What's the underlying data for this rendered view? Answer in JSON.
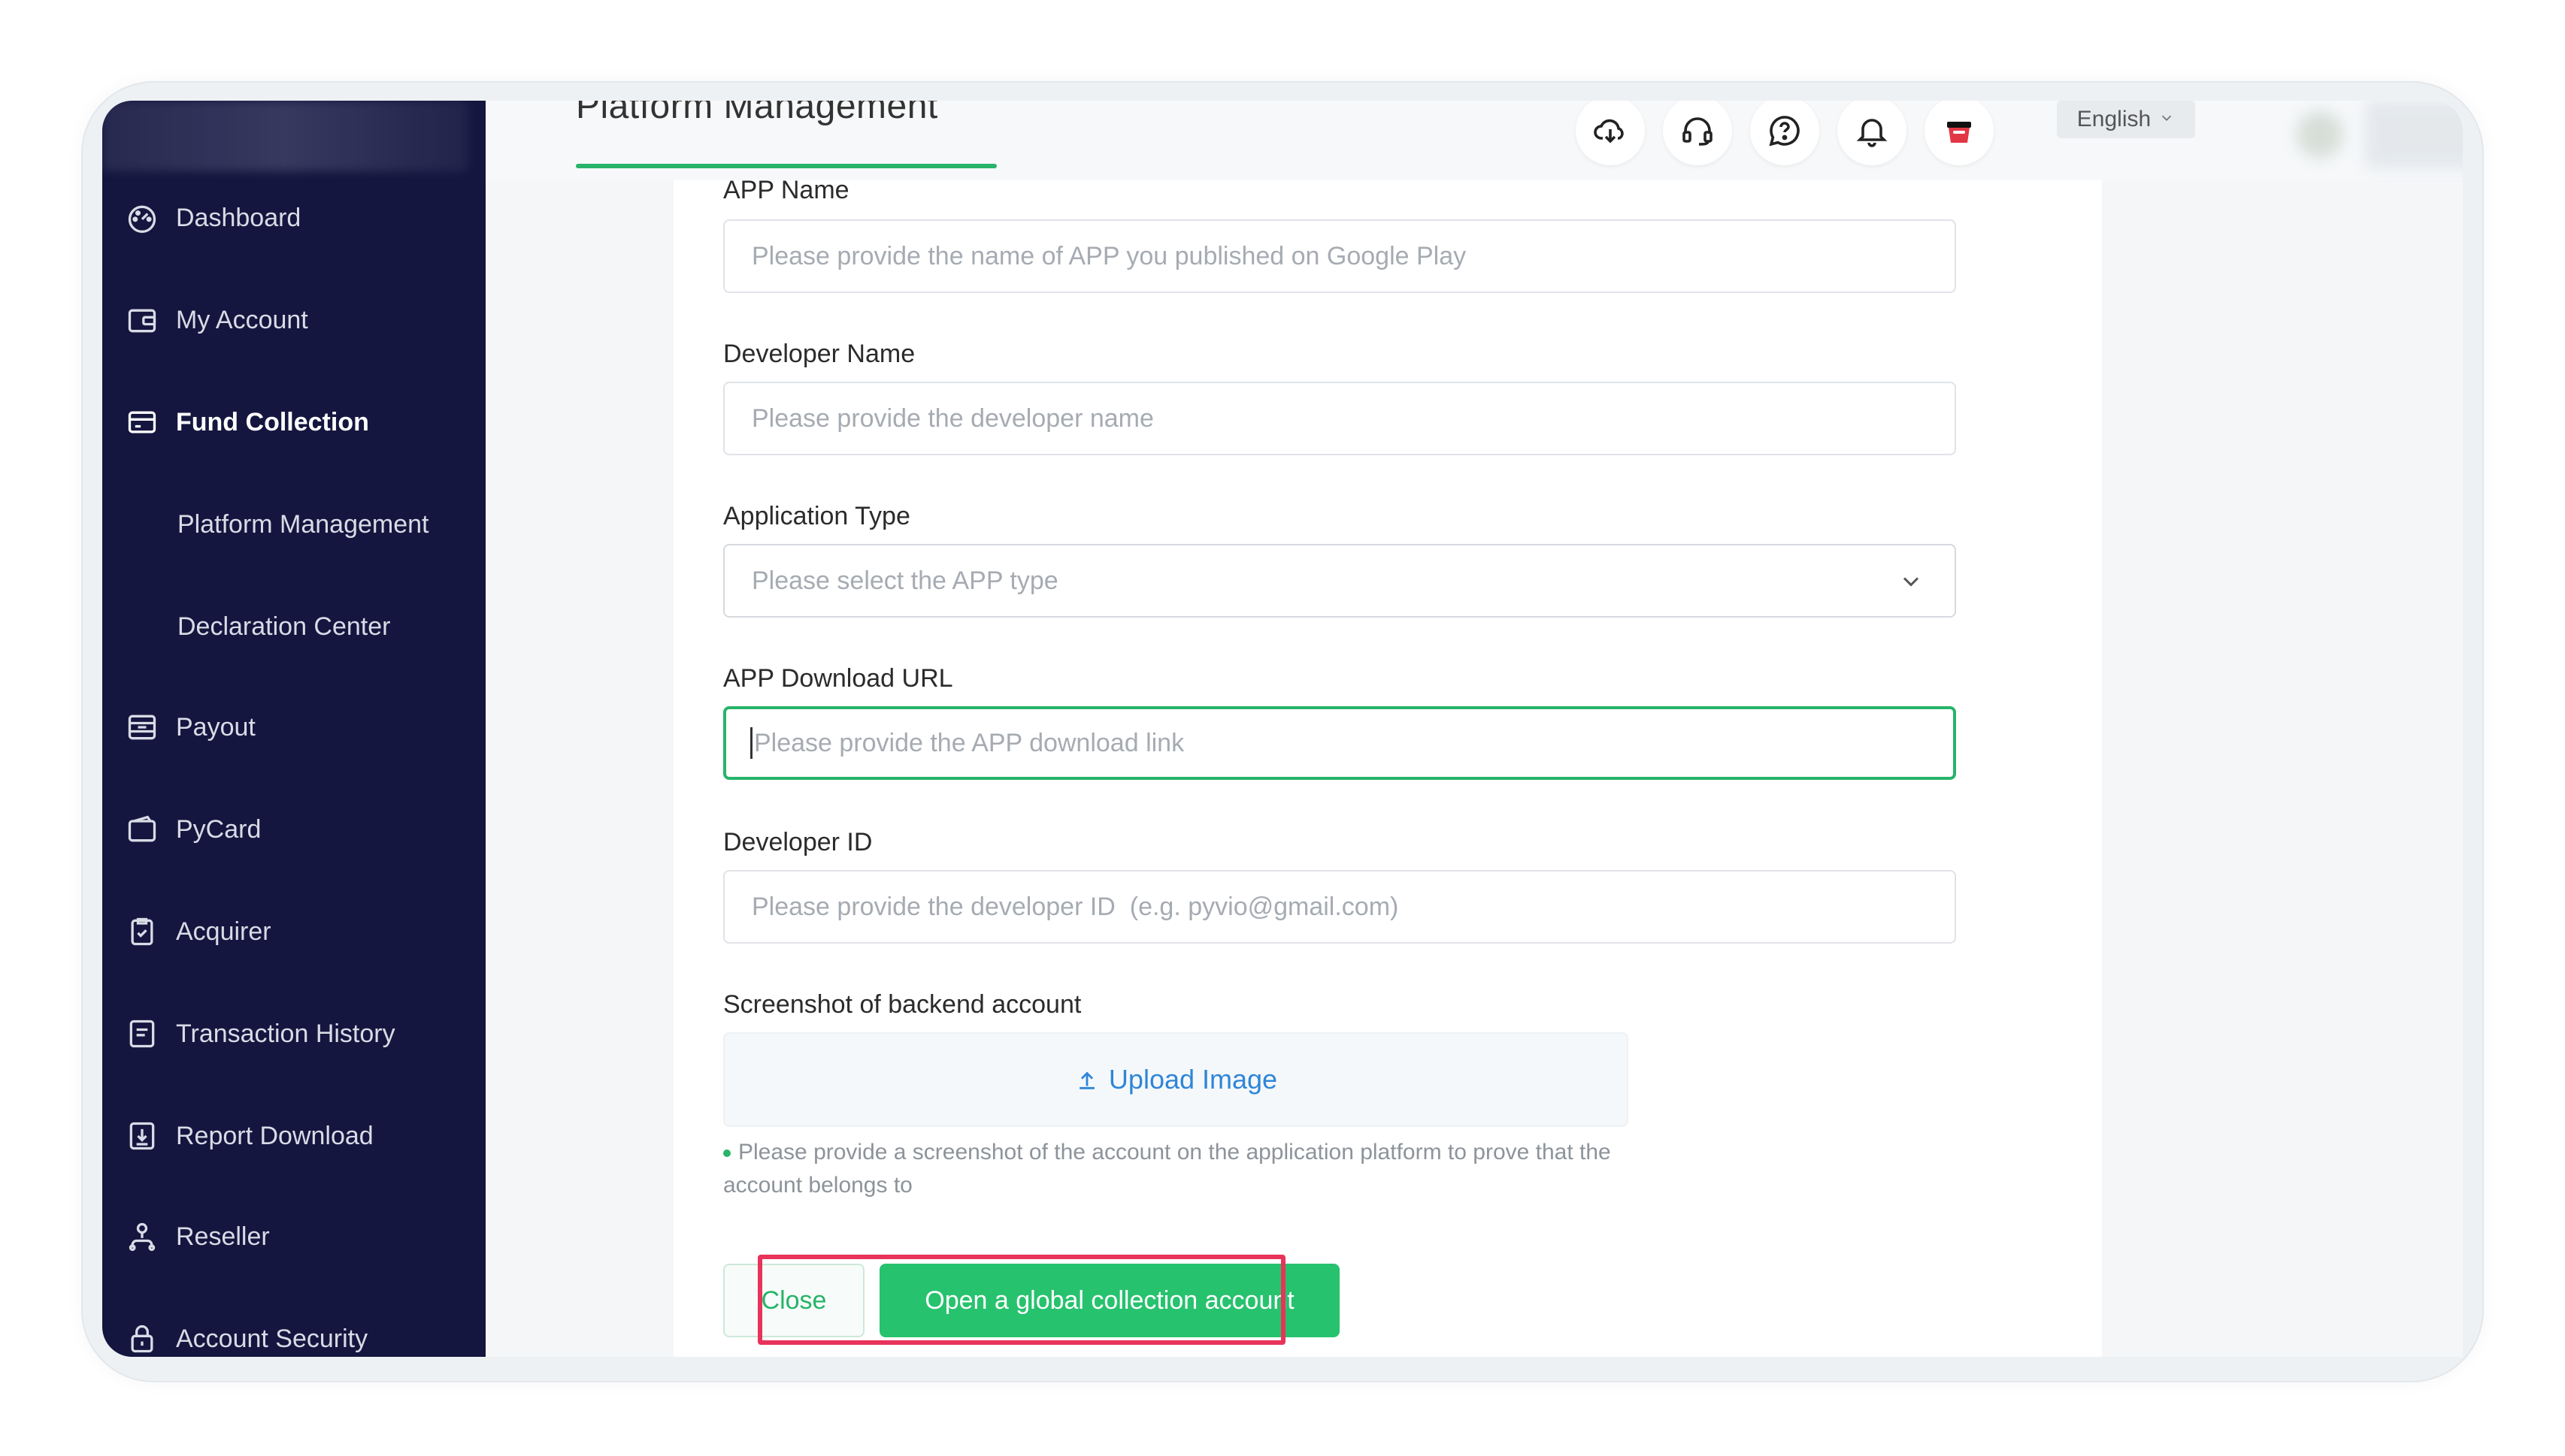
{
  "header": {
    "page_title": "Platform Management",
    "language": "English",
    "icons": [
      "download-cloud-icon",
      "headset-support-icon",
      "help-bubble-icon",
      "bell-icon",
      "gift-box-icon"
    ]
  },
  "sidebar": {
    "items": [
      {
        "label": "Dashboard",
        "icon": "dashboard-gauge-icon"
      },
      {
        "label": "My Account",
        "icon": "wallet-icon"
      },
      {
        "label": "Fund Collection",
        "icon": "card-icon",
        "active": true
      },
      {
        "label": "Platform Management",
        "sub": true
      },
      {
        "label": "Declaration Center",
        "sub": true
      },
      {
        "label": "Payout",
        "icon": "payout-icon"
      },
      {
        "label": "PyCard",
        "icon": "pycard-icon"
      },
      {
        "label": "Acquirer",
        "icon": "clipboard-check-icon"
      },
      {
        "label": "Transaction History",
        "icon": "document-list-icon"
      },
      {
        "label": "Report Download",
        "icon": "report-download-icon"
      },
      {
        "label": "Reseller",
        "icon": "network-icon"
      },
      {
        "label": "Account Security",
        "icon": "lock-icon"
      }
    ]
  },
  "form": {
    "app_name": {
      "label": "APP Name",
      "placeholder": "Please provide the name of APP you published on Google Play"
    },
    "developer_name": {
      "label": "Developer Name",
      "placeholder": "Please provide the developer name"
    },
    "application_type": {
      "label": "Application Type",
      "placeholder": "Please select the APP type"
    },
    "app_download_url": {
      "label": "APP Download URL",
      "placeholder": "Please provide the APP download link"
    },
    "developer_id": {
      "label": "Developer ID",
      "placeholder": "Please provide the developer ID  (e.g. pyvio@gmail.com)"
    },
    "screenshot": {
      "label": "Screenshot of backend account",
      "upload_label": "Upload Image",
      "note": "Please provide a screenshot of the account on the application platform to prove that the account belongs to"
    },
    "close_label": "Close",
    "submit_label": "Open a global collection account"
  },
  "colors": {
    "sidebar_bg": "#14163f",
    "accent_green": "#27c26e",
    "highlight_red": "#e8335a",
    "link_blue": "#2f86d6"
  }
}
